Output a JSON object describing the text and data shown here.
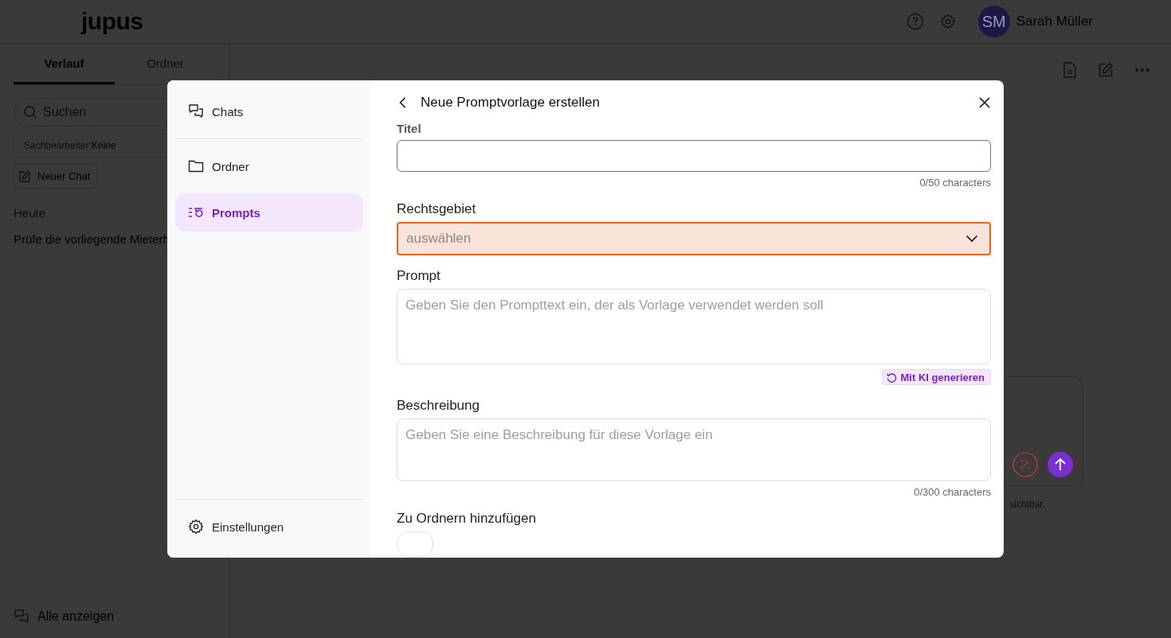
{
  "header": {
    "logo": "jupus",
    "user": {
      "initials": "SM",
      "name": "Sarah Müller"
    }
  },
  "sidebar": {
    "tabs": [
      {
        "label": "Verlauf",
        "selected": true
      },
      {
        "label": "Ordner",
        "selected": false
      }
    ],
    "search": {
      "placeholder": "Suchen"
    },
    "filter": {
      "label": "Sachbearbeiter:",
      "value": "Keine"
    },
    "new_chat": "Neuer Chat",
    "group": "Heute",
    "chats": [
      "Prüfe die vorliegende Mieterh"
    ],
    "footer": "Alle anzeigen"
  },
  "main": {
    "disclaimer": "sichtbar."
  },
  "modal": {
    "nav": [
      {
        "label": "Chats",
        "kind": "chats",
        "selected": false
      },
      {
        "label": "Ordner",
        "kind": "folder",
        "selected": false
      },
      {
        "label": "Prompts",
        "kind": "prompts",
        "selected": true
      }
    ],
    "nav_footer": "Einstellungen",
    "title": "Neue Promptvorlage erstellen",
    "fields": [
      {
        "kind": "input",
        "label": "Titel",
        "counter": "0/50 characters"
      },
      {
        "kind": "select",
        "label": "Rechtsgebiet",
        "placeholder": "auswählen",
        "error": true
      },
      {
        "kind": "textarea",
        "label": "Prompt",
        "placeholder": "Geben Sie den Prompttext ein, der als Vorlage verwendet werden soll",
        "action": "Mit KI generieren"
      },
      {
        "kind": "textarea",
        "label": "Beschreibung",
        "placeholder": "Geben Sie eine Beschreibung für diese Vorlage ein",
        "counter": "0/300 characters"
      },
      {
        "kind": "chips",
        "label": "Zu Ordnern hinzufügen"
      }
    ]
  }
}
